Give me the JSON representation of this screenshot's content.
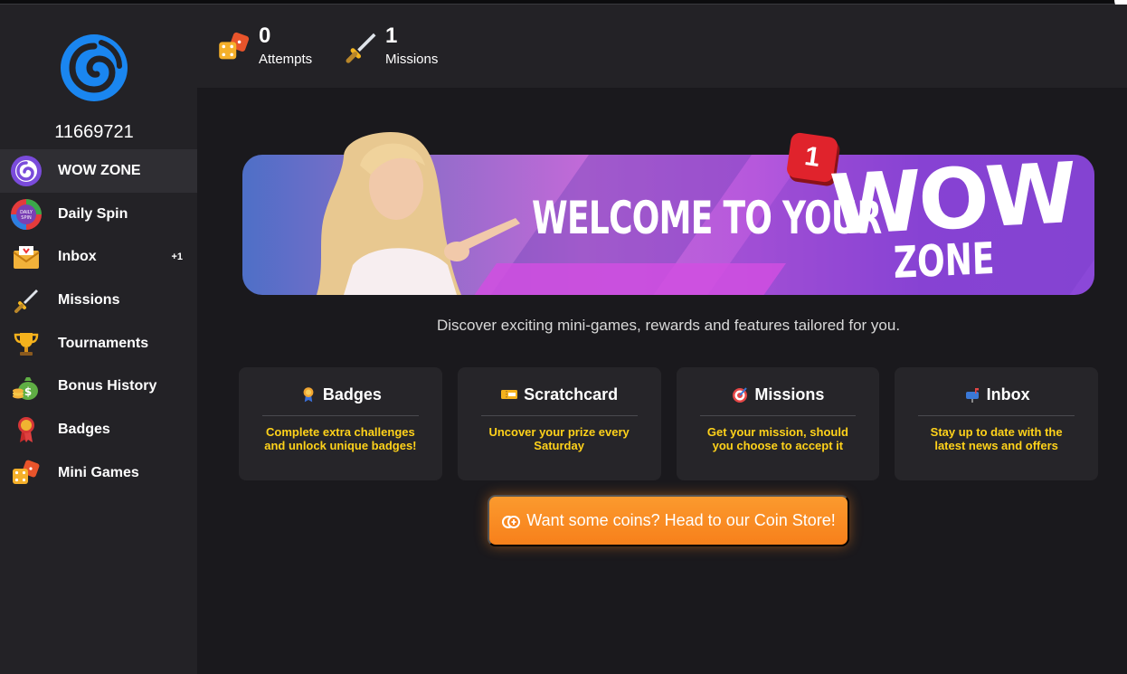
{
  "user": {
    "id": "11669721"
  },
  "sidebar": {
    "items": [
      {
        "label": "WOW ZONE",
        "icon": "wow-zone-icon",
        "active": true
      },
      {
        "label": "Daily Spin",
        "icon": "daily-spin-icon"
      },
      {
        "label": "Inbox",
        "icon": "inbox-icon",
        "badge": "+1"
      },
      {
        "label": "Missions",
        "icon": "sword-icon"
      },
      {
        "label": "Tournaments",
        "icon": "trophy-icon"
      },
      {
        "label": "Bonus History",
        "icon": "money-bag-icon"
      },
      {
        "label": "Badges",
        "icon": "medal-icon"
      },
      {
        "label": "Mini Games",
        "icon": "dice-icon"
      }
    ]
  },
  "stats": {
    "attempts": {
      "value": "0",
      "label": "Attempts"
    },
    "missions": {
      "value": "1",
      "label": "Missions"
    }
  },
  "banner": {
    "welcome": "WELCOME TO YOUR",
    "wow": "WOW",
    "zone": "ZONE",
    "notification": "1"
  },
  "tagline": "Discover exciting mini-games, rewards and features tailored for you.",
  "cards": [
    {
      "title": "Badges",
      "icon": "medal-icon",
      "desc": "Complete extra challenges and unlock unique badges!"
    },
    {
      "title": "Scratchcard",
      "icon": "ticket-icon",
      "desc": "Uncover your prize every Saturday"
    },
    {
      "title": "Missions",
      "icon": "target-icon",
      "desc": "Get your mission, should you choose to accept it"
    },
    {
      "title": "Inbox",
      "icon": "mailbox-icon",
      "desc": "Stay up to date with the latest news and offers"
    }
  ],
  "coin_store": {
    "label": "Want some coins? Head to our Coin Store!"
  },
  "colors": {
    "accent": "#f7801b",
    "card_text": "#ffd21a",
    "logo": "#1a86f0",
    "badge_red": "#e0232c"
  }
}
